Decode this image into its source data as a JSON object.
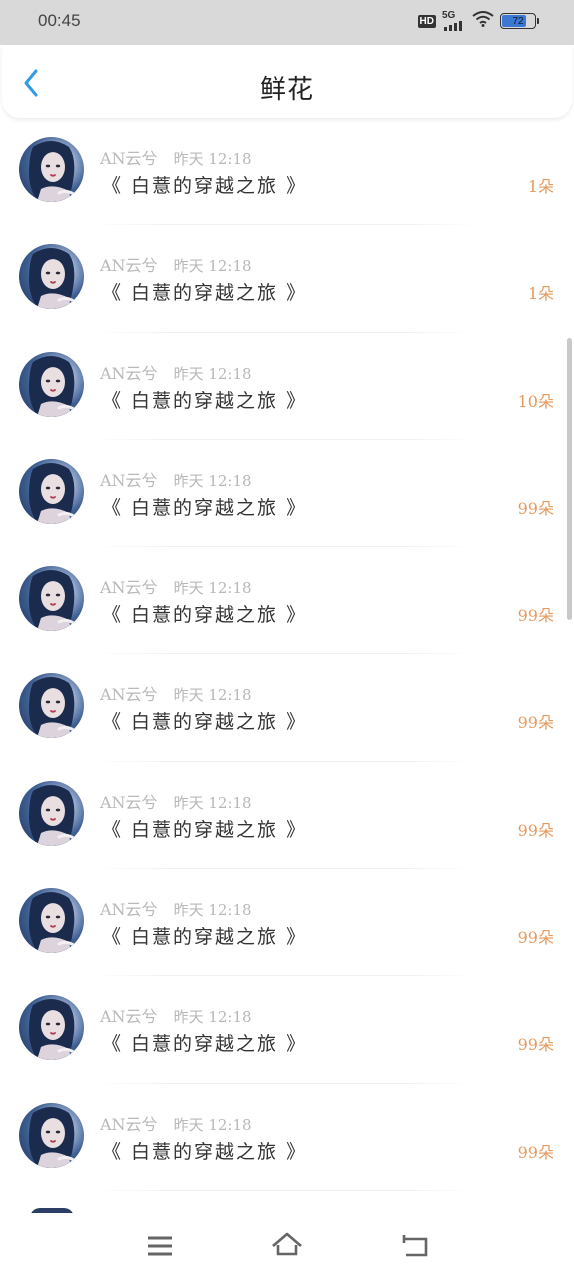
{
  "status_bar": {
    "time": "00:45",
    "hd_label": "HD",
    "network_label": "5G",
    "battery_level": "72"
  },
  "header": {
    "title": "鲜花",
    "back_icon": "chevron-left-icon",
    "accent_color": "#2f9be8"
  },
  "items": [
    {
      "user": "AN云兮",
      "time": "昨天 12:18",
      "book": "《 白薏的穿越之旅 》",
      "count": "1朵"
    },
    {
      "user": "AN云兮",
      "time": "昨天 12:18",
      "book": "《 白薏的穿越之旅 》",
      "count": "1朵"
    },
    {
      "user": "AN云兮",
      "time": "昨天 12:18",
      "book": "《 白薏的穿越之旅 》",
      "count": "10朵"
    },
    {
      "user": "AN云兮",
      "time": "昨天 12:18",
      "book": "《 白薏的穿越之旅 》",
      "count": "99朵"
    },
    {
      "user": "AN云兮",
      "time": "昨天 12:18",
      "book": "《 白薏的穿越之旅 》",
      "count": "99朵"
    },
    {
      "user": "AN云兮",
      "time": "昨天 12:18",
      "book": "《 白薏的穿越之旅 》",
      "count": "99朵"
    },
    {
      "user": "AN云兮",
      "time": "昨天 12:18",
      "book": "《 白薏的穿越之旅 》",
      "count": "99朵"
    },
    {
      "user": "AN云兮",
      "time": "昨天 12:18",
      "book": "《 白薏的穿越之旅 》",
      "count": "99朵"
    },
    {
      "user": "AN云兮",
      "time": "昨天 12:18",
      "book": "《 白薏的穿越之旅 》",
      "count": "99朵"
    },
    {
      "user": "AN云兮",
      "time": "昨天 12:18",
      "book": "《 白薏的穿越之旅 》",
      "count": "99朵"
    }
  ],
  "count_color": "#e59a5e",
  "nav": {
    "menu_icon": "menu-icon",
    "home_icon": "home-icon",
    "back_icon": "back-icon"
  }
}
